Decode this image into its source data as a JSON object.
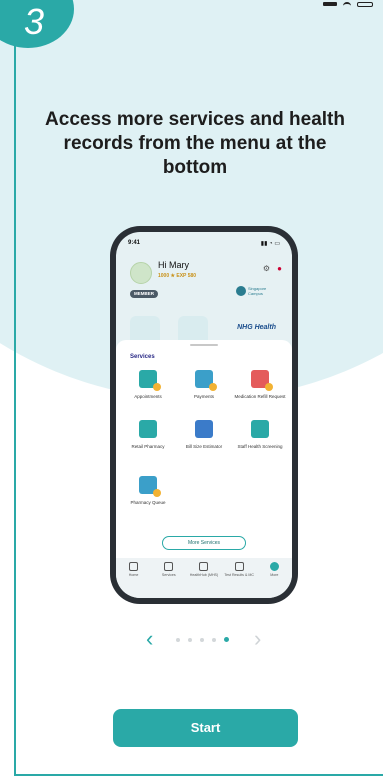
{
  "step": {
    "number": "3"
  },
  "headline": "Access more services and health records from the menu at the bottom",
  "colors": {
    "accent": "#2aa9a7",
    "background_blob": "#dff1f4"
  },
  "phone": {
    "time": "9:41",
    "greeting": "Hi Mary",
    "points": "1000 ★ EXP 580",
    "member_badge": "MEMBER",
    "partner": "Singapore Campus",
    "nhg": "NHG Health",
    "services": {
      "title": "Services",
      "items": [
        {
          "label": "Appointments",
          "icon": "calendar-icon"
        },
        {
          "label": "Payments",
          "icon": "payments-icon"
        },
        {
          "label": "Medication Refill Request",
          "icon": "medication-icon"
        },
        {
          "label": "Retail Pharmacy",
          "icon": "retail-pharmacy-icon"
        },
        {
          "label": "Bill Size Estimator",
          "icon": "calculator-icon"
        },
        {
          "label": "Staff Health Screening",
          "icon": "screening-icon"
        },
        {
          "label": "Pharmacy Queue",
          "icon": "queue-icon"
        }
      ],
      "more_button": "More Services"
    },
    "tabs": [
      {
        "label": "Home"
      },
      {
        "label": "Services"
      },
      {
        "label": "HealthHub (MHS)"
      },
      {
        "label": "Test Results & MC"
      },
      {
        "label": "More"
      }
    ]
  },
  "pagination": {
    "total": 5,
    "current": 5
  },
  "start_button": "Start"
}
